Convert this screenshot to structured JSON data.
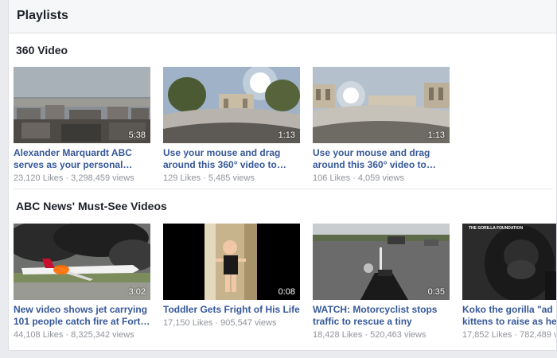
{
  "header": {
    "title": "Playlists"
  },
  "sections": [
    {
      "title": "360 Video",
      "videos": [
        {
          "title": "Alexander Marquardt ABC\nserves as your personal…",
          "duration": "5:38",
          "meta": "23,120 Likes · 3,298,459 views"
        },
        {
          "title": "Use your mouse and drag\naround this 360° video to…",
          "duration": "1:13",
          "meta": "129 Likes · 5,485 views"
        },
        {
          "title": "Use your mouse and drag\naround this 360° video to…",
          "duration": "1:13",
          "meta": "106 Likes · 4,059 views"
        }
      ]
    },
    {
      "title": "ABC News' Must-See Videos",
      "videos": [
        {
          "title": "New video shows jet carrying\n101 people catch fire at Fort…",
          "duration": "3:02",
          "meta": "44,108 Likes · 8,325,342 views"
        },
        {
          "title": "Toddler Gets Fright of His Life",
          "duration": "0:08",
          "meta": "17,150 Likes · 905,547 views"
        },
        {
          "title": "WATCH: Motorcyclist stops\ntraffic to rescue a tiny kitten…",
          "duration": "0:35",
          "meta": "18,428 Likes · 520,463 views"
        },
        {
          "title": "Koko the gorilla \"ad\nkittens to raise as he",
          "duration": "",
          "meta": "17,852 Likes · 782,489 vie",
          "thumb_text": "THE GORILLA FOUNDATION"
        }
      ]
    }
  ],
  "colors": {
    "link": "#365899",
    "meta": "#90949c",
    "background": "#e9ebee",
    "header": "#f6f7f9"
  }
}
